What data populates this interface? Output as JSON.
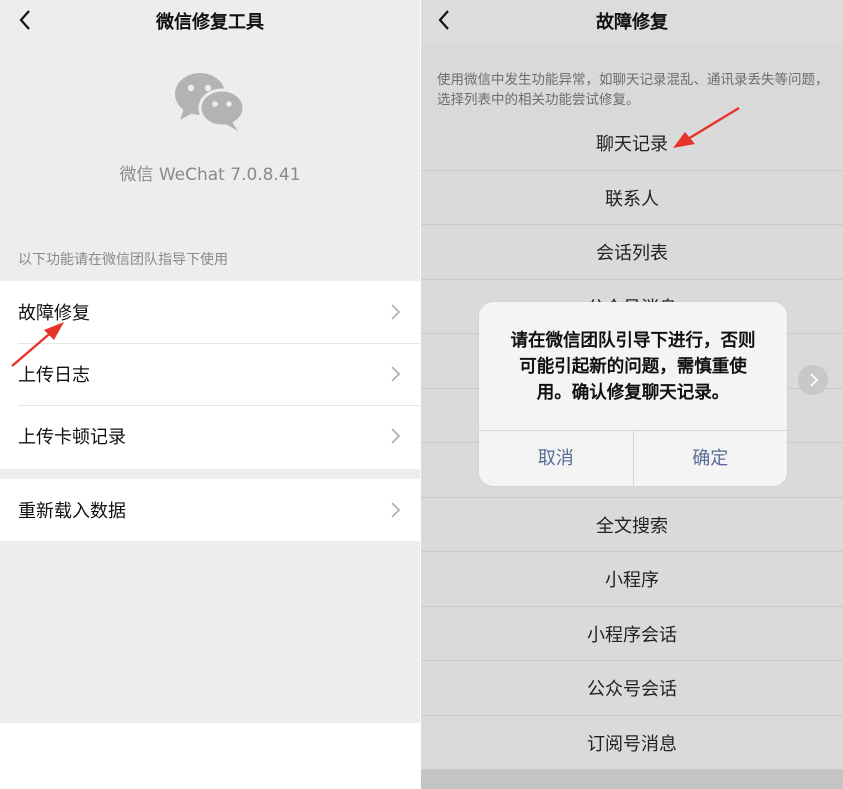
{
  "left": {
    "nav_title": "微信修复工具",
    "version": "微信 WeChat 7.0.8.41",
    "hint": "以下功能请在微信团队指导下使用",
    "group1": [
      {
        "label": "故障修复"
      },
      {
        "label": "上传日志"
      },
      {
        "label": "上传卡顿记录"
      }
    ],
    "group2": [
      {
        "label": "重新载入数据"
      }
    ]
  },
  "right": {
    "nav_title": "故障修复",
    "description": "使用微信中发生功能异常，如聊天记录混乱、通讯录丢失等问题，选择列表中的相关功能尝试修复。",
    "items": [
      {
        "label": "聊天记录"
      },
      {
        "label": "联系人"
      },
      {
        "label": "会话列表"
      },
      {
        "label": "公众号消息"
      },
      {
        "label": ""
      },
      {
        "label": ""
      },
      {
        "label": ""
      },
      {
        "label": "全文搜索"
      },
      {
        "label": "小程序"
      },
      {
        "label": "小程序会话"
      },
      {
        "label": "公众号会话"
      },
      {
        "label": "订阅号消息"
      }
    ],
    "dialog": {
      "message": "请在微信团队引导下进行，否则可能引起新的问题，需慎重使用。确认修复聊天记录。",
      "cancel": "取消",
      "confirm": "确定"
    }
  },
  "icons": {
    "back": "chevron-left-icon",
    "chevron": "chevron-right-icon",
    "logo": "wechat-logo-icon",
    "arrow": "red-arrow-icon"
  },
  "colors": {
    "link_blue": "#576b95",
    "arrow_red": "#e8332b",
    "bg_gray": "#ededed"
  }
}
